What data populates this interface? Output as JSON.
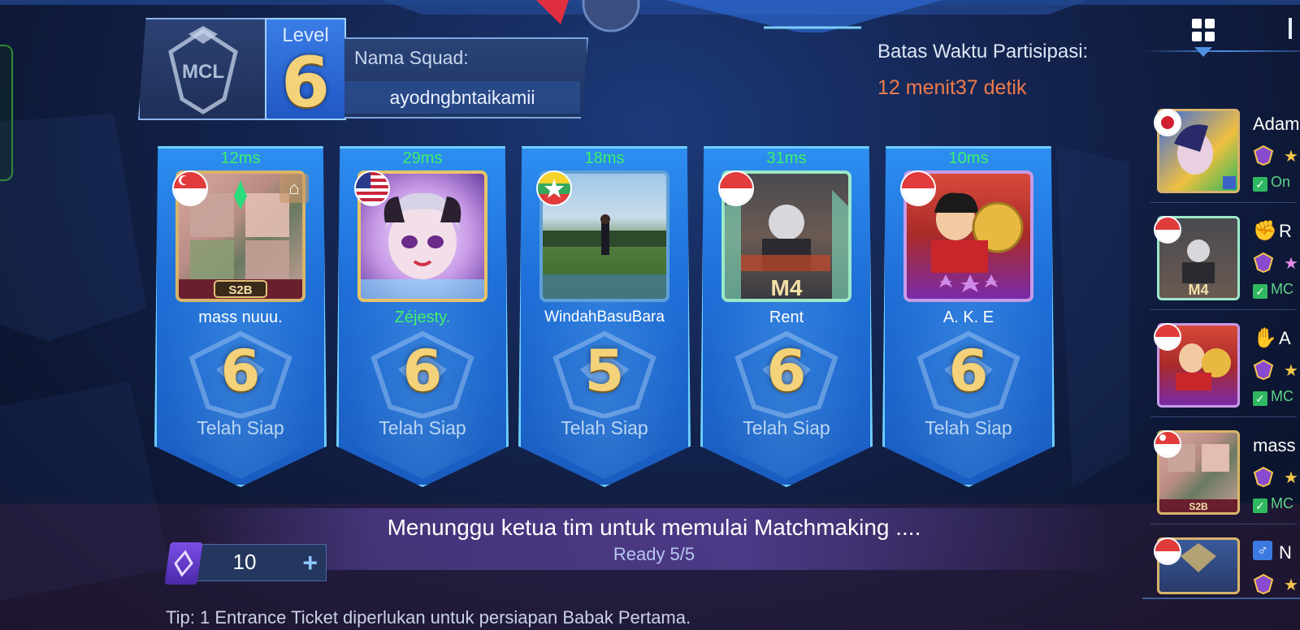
{
  "squad": {
    "emblem_text": "MCL",
    "level_label": "Level",
    "level_value": "6",
    "name_label": "Nama Squad:",
    "name_value": "ayodngbntaikamii"
  },
  "timer": {
    "label": "Batas Waktu Partisipasi:",
    "value": "12 menit37 detik"
  },
  "players": [
    {
      "ping": "12ms",
      "flag": "singapore",
      "name": "mass nuuu.",
      "name_color": "white",
      "rank": "6",
      "status": "Telah Siap",
      "avatar_tag": "S2B",
      "has_home_icon": true
    },
    {
      "ping": "29ms",
      "flag": "usa",
      "name": "Zéjesty.",
      "name_color": "green",
      "rank": "6",
      "status": "Telah Siap",
      "avatar_tag": "",
      "has_home_icon": false
    },
    {
      "ping": "18ms",
      "flag": "myanmar",
      "name": "WindahBasuBara",
      "name_color": "white",
      "rank": "5",
      "status": "Telah Siap",
      "avatar_tag": "",
      "has_home_icon": false
    },
    {
      "ping": "31ms",
      "flag": "indonesia",
      "name": "Rent",
      "name_color": "white",
      "rank": "6",
      "status": "Telah Siap",
      "avatar_tag": "M4",
      "has_home_icon": false
    },
    {
      "ping": "10ms",
      "flag": "indonesia",
      "name": "A. K. E",
      "name_color": "white",
      "rank": "6",
      "status": "Telah Siap",
      "avatar_tag": "",
      "has_home_icon": false
    }
  ],
  "waiting": {
    "message": "Menunggu ketua tim untuk memulai Matchmaking ....",
    "ready": "Ready 5/5"
  },
  "ticket": {
    "count": "10",
    "plus_label": "+"
  },
  "tip": "Tip: 1 Entrance Ticket diperlukan untuk persiapan Babak Pertama.",
  "sidebar": {
    "items": [
      {
        "name": "Adam",
        "flag": "japan",
        "status": "On",
        "avatar_tag": ""
      },
      {
        "name": "R",
        "flag": "indonesia",
        "status": "MC",
        "avatar_tag": "M4"
      },
      {
        "name": "A",
        "flag": "indonesia",
        "status": "MC",
        "avatar_tag": ""
      },
      {
        "name": "mass",
        "flag": "singapore",
        "status": "MC",
        "avatar_tag": "S2B"
      },
      {
        "name": "N",
        "flag": "indonesia",
        "status": "",
        "avatar_tag": ""
      }
    ]
  },
  "colors": {
    "accent_blue": "#2d8ef0",
    "gold": "#f3d27a",
    "ping_green": "#3cf06a",
    "timer_orange": "#f07b4a"
  }
}
